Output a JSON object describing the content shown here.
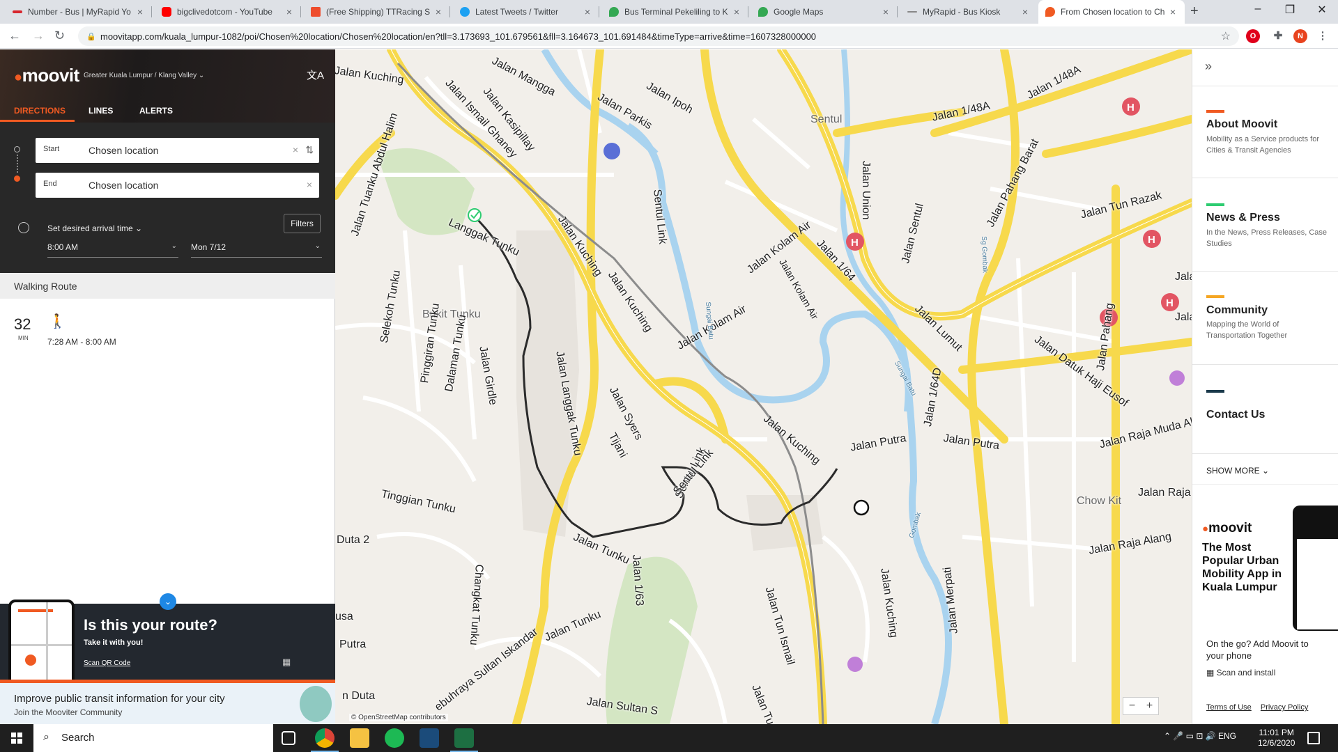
{
  "browser": {
    "tabs": [
      {
        "title": "Number - Bus | MyRapid Yo",
        "color": "#d7262e"
      },
      {
        "title": "bigclivedotcom - YouTube",
        "color": "#ff0000"
      },
      {
        "title": "(Free Shipping) TTRacing S",
        "color": "#ee4d2d"
      },
      {
        "title": "Latest Tweets / Twitter",
        "color": "#1da1f2"
      },
      {
        "title": "Bus Terminal Pekeliling to K",
        "color": "#34a853"
      },
      {
        "title": "Google Maps",
        "color": "#34a853"
      },
      {
        "title": "MyRapid - Bus Kiosk",
        "color": "#888888"
      },
      {
        "title": "From Chosen location to Ch",
        "color": "#f05a22"
      }
    ],
    "url": "moovitapp.com/kuala_lumpur-1082/poi/Chosen%20location/Chosen%20location/en?tll=3.173693_101.679561&fll=3.164673_101.691484&timeType=arrive&time=1607328000000",
    "profile_initial": "N"
  },
  "moovit": {
    "logo": "moovit",
    "region": "Greater Kuala Lumpur / Klang Valley",
    "nav": {
      "directions": "DIRECTIONS",
      "lines": "LINES",
      "alerts": "ALERTS"
    },
    "start": {
      "label": "Start",
      "value": "Chosen location"
    },
    "end": {
      "label": "End",
      "value": "Chosen location"
    },
    "arrival_label": "Set desired arrival time",
    "filters": "Filters",
    "time_value": "8:00 AM",
    "date_value": "Mon 7/12",
    "route_header": "Walking Route",
    "duration": "32",
    "duration_unit": "MIN",
    "time_range": "7:28 AM  -  8:00 AM",
    "promo": {
      "title": "Is this your route?",
      "subtitle": "Take it with you!",
      "link": "Scan QR Code"
    },
    "community": {
      "title": "Improve public transit information for your city",
      "subtitle": "Join the Mooviter Community"
    }
  },
  "map": {
    "attribution": "© OpenStreetMap contributors",
    "labels": [
      "Jalan Kuching",
      "Jalan Mangga",
      "Jalan Ismail Ghaney",
      "Jalan Kasipillay",
      "Jalan Parkis",
      "Jalan Ipoh",
      "Sentul",
      "Jalan Union",
      "Jalan 1/48A",
      "Jalan 1/48A",
      "Jalan Tuanku Abdul Halim",
      "Langgak Tunku",
      "Jalan Kuching",
      "Jalan Kuching",
      "Sentul Link",
      "Jalan Kolam Air",
      "Jalan 1/64",
      "Jalan Sentul",
      "Jalan Pahang Barat",
      "Jalan Tun Razak",
      "Selekoh Tunku",
      "Bukit Tunku",
      "Pinggiran Tunku",
      "Dalaman Tunku",
      "Jalan Girdle",
      "Jalan Langgak Tunku",
      "Jalan Syers",
      "Tijani",
      "Sentul Link",
      "Jalan Kolam Air",
      "Jalan Kolam Air",
      "Jalan Lumut",
      "Jalan Datuk Haji Eusof",
      "Jalan Pahang",
      "Jalan Raja Muda Ab",
      "Jalan 1/64D",
      "Jalan Putra",
      "Jalan Putra",
      "Jalan Kuching",
      "Sentul Link",
      "Tinggian Tunku",
      "Duta 2",
      "Chow Kit",
      "Jalan Raja",
      "Jalan Tunku",
      "Jalan 1/63",
      "Jalan Raja Alang",
      "Jalan Tunku",
      "Changkat Tunku",
      "Jalan Tun Ismail",
      "Jalan Kuching",
      "Jalan Merpati",
      "usa",
      "Putra",
      "n Duta",
      "ebuhraya Sultan Iskandar",
      "Jalan Sultan S",
      "Jalan Tun Is",
      "Jala",
      "Jalan",
      "Sungai Batu",
      "Sungai Batu",
      "Sg Gombak",
      "Gombak"
    ]
  },
  "sidebar": {
    "sections": [
      {
        "title": "About Moovit",
        "sub": "Mobility as a Service products for Cities & Transit Agencies",
        "color": "#f05a22"
      },
      {
        "title": "News & Press",
        "sub": "In the News, Press Releases, Case Studies",
        "color": "#2ecc71"
      },
      {
        "title": "Community",
        "sub": "Mapping the World of Transportation Together",
        "color": "#f5a623"
      },
      {
        "title": "Contact Us",
        "sub": "",
        "color": "#1b3a4b"
      }
    ],
    "show_more": "SHOW MORE",
    "ad_logo": "moovit",
    "ad_text": "The Most Popular Urban Mobility App in Kuala Lumpur",
    "on_the_go": "On the go? Add Moovit to your phone",
    "scan_install": "Scan and install",
    "terms": "Terms of Use",
    "privacy": "Privacy Policy"
  },
  "taskbar": {
    "search_placeholder": "Search",
    "lang": "ENG",
    "time": "11:01 PM",
    "date": "12/6/2020"
  }
}
